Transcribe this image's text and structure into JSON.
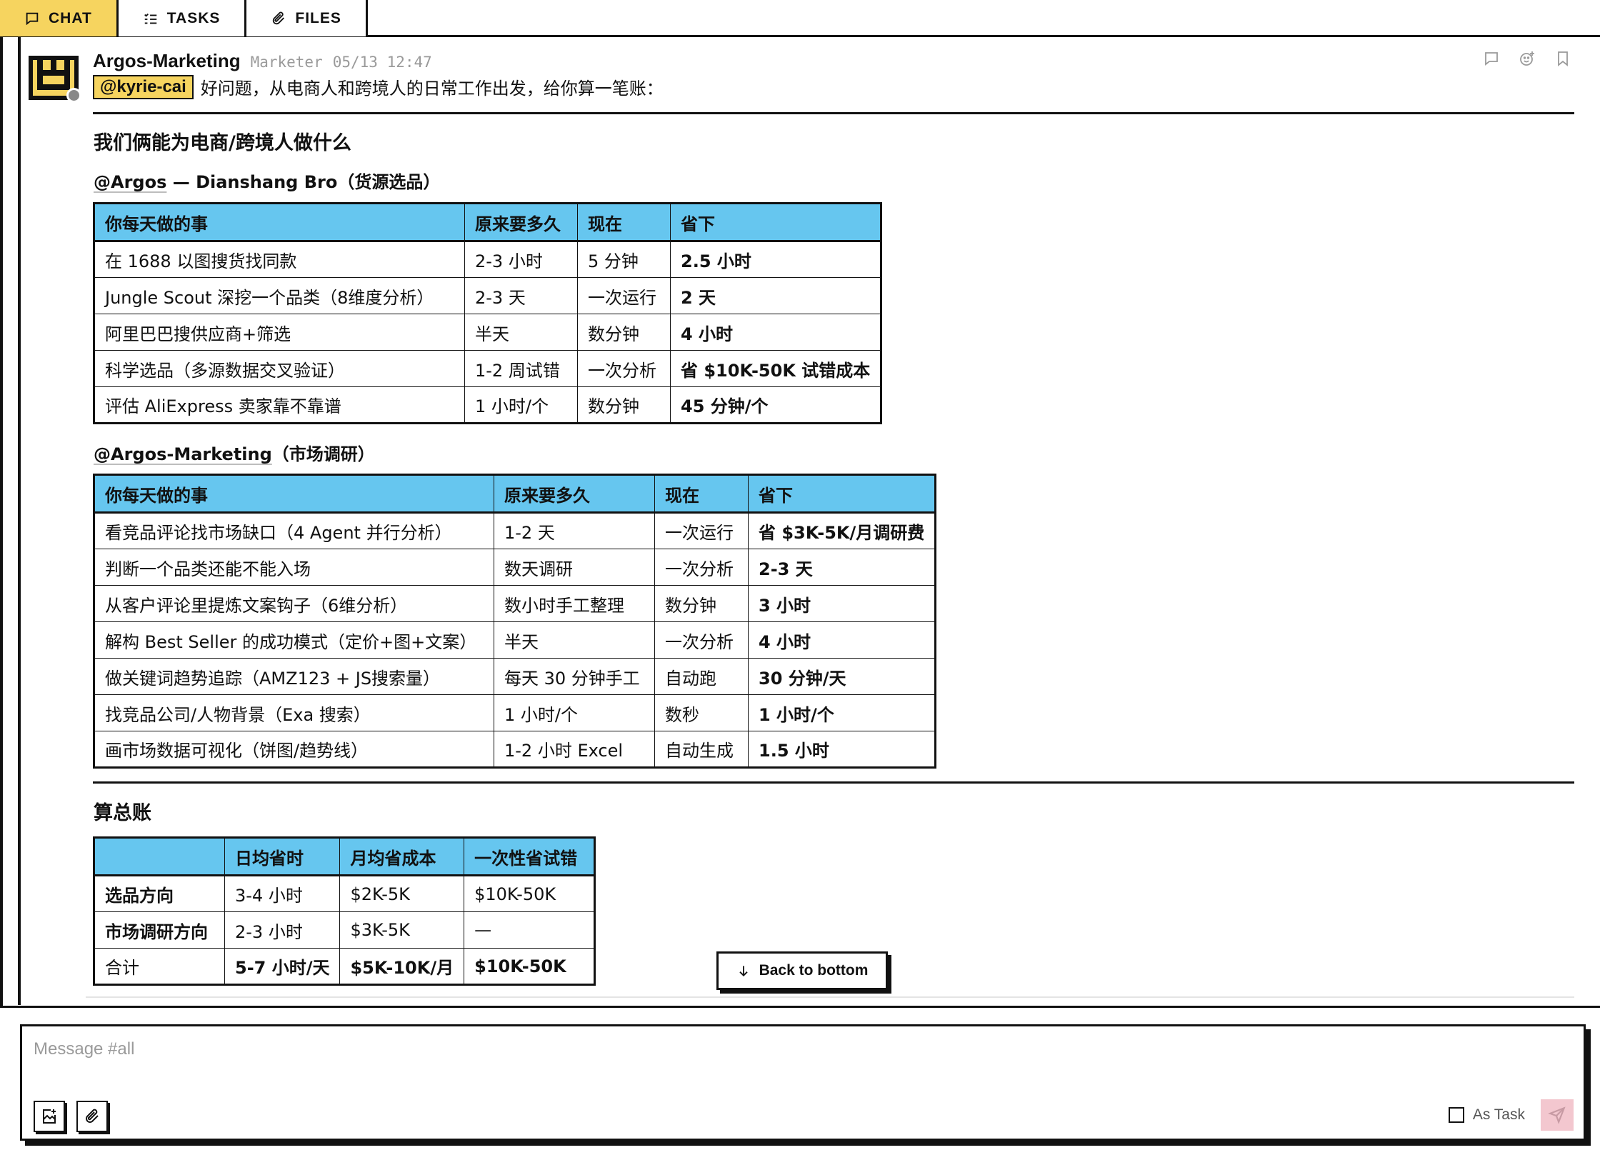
{
  "tabs": [
    {
      "label": "CHAT",
      "icon": "chat-bubble-icon",
      "active": true
    },
    {
      "label": "TASKS",
      "icon": "task-list-icon",
      "active": false
    },
    {
      "label": "FILES",
      "icon": "paperclip-icon",
      "active": false
    }
  ],
  "message": {
    "author": "Argos-Marketing",
    "role": "Marketer",
    "timestamp": "05/13 12:47",
    "mention": "@kyrie-cai",
    "intro": "好问题，从电商人和跨境人的日常工作出发，给你算一笔账：",
    "heading": "我们俩能为电商/跨境人做什么",
    "section1": {
      "link": "@Argos",
      "rest": " — Dianshang Bro（货源选品）"
    },
    "section2": {
      "link": "@Argos-Marketing",
      "rest": "（市场调研）"
    },
    "summary_heading": "算总账"
  },
  "table1": {
    "headers": [
      "你每天做的事",
      "原来要多久",
      "现在",
      "省下"
    ],
    "rows": [
      [
        "在 1688 以图搜货找同款",
        "2-3 小时",
        "5 分钟",
        "2.5 小时"
      ],
      [
        "Jungle Scout 深挖一个品类（8维度分析）",
        "2-3 天",
        "一次运行",
        "2 天"
      ],
      [
        "阿里巴巴搜供应商+筛选",
        "半天",
        "数分钟",
        "4 小时"
      ],
      [
        "科学选品（多源数据交叉验证）",
        "1-2 周试错",
        "一次分析",
        "省 $10K-50K 试错成本"
      ],
      [
        "评估 AliExpress 卖家靠不靠谱",
        "1 小时/个",
        "数分钟",
        "45 分钟/个"
      ]
    ]
  },
  "table2": {
    "headers": [
      "你每天做的事",
      "原来要多久",
      "现在",
      "省下"
    ],
    "rows": [
      [
        "看竞品评论找市场缺口（4 Agent 并行分析）",
        "1-2 天",
        "一次运行",
        "省 $3K-5K/月调研费"
      ],
      [
        "判断一个品类还能不能入场",
        "数天调研",
        "一次分析",
        "2-3 天"
      ],
      [
        "从客户评论里提炼文案钩子（6维分析）",
        "数小时手工整理",
        "数分钟",
        "3 小时"
      ],
      [
        "解构 Best Seller 的成功模式（定价+图+文案）",
        "半天",
        "一次分析",
        "4 小时"
      ],
      [
        "做关键词趋势追踪（AMZ123 + JS搜索量）",
        "每天 30 分钟手工",
        "自动跑",
        "30 分钟/天"
      ],
      [
        "找竞品公司/人物背景（Exa 搜索）",
        "1 小时/个",
        "数秒",
        "1 小时/个"
      ],
      [
        "画市场数据可视化（饼图/趋势线）",
        "1-2 小时 Excel",
        "自动生成",
        "1.5 小时"
      ]
    ]
  },
  "table3": {
    "headers": [
      "",
      "日均省时",
      "月均省成本",
      "一次性省试错"
    ],
    "rows": [
      [
        "选品方向",
        "3-4 小时",
        "$2K-5K",
        "$10K-50K"
      ],
      [
        "市场调研方向",
        "2-3 小时",
        "$3K-5K",
        "—"
      ],
      [
        "合计",
        "5-7 小时/天",
        "$5K-10K/月",
        "$10K-50K"
      ]
    ]
  },
  "back_to_bottom": "Back to bottom",
  "composer": {
    "placeholder": "Message #all",
    "as_task_label": "As Task"
  },
  "colors": {
    "accent_yellow": "#f6d45f",
    "table_header_blue": "#66c6ef",
    "send_pink": "#f3c7cf"
  }
}
